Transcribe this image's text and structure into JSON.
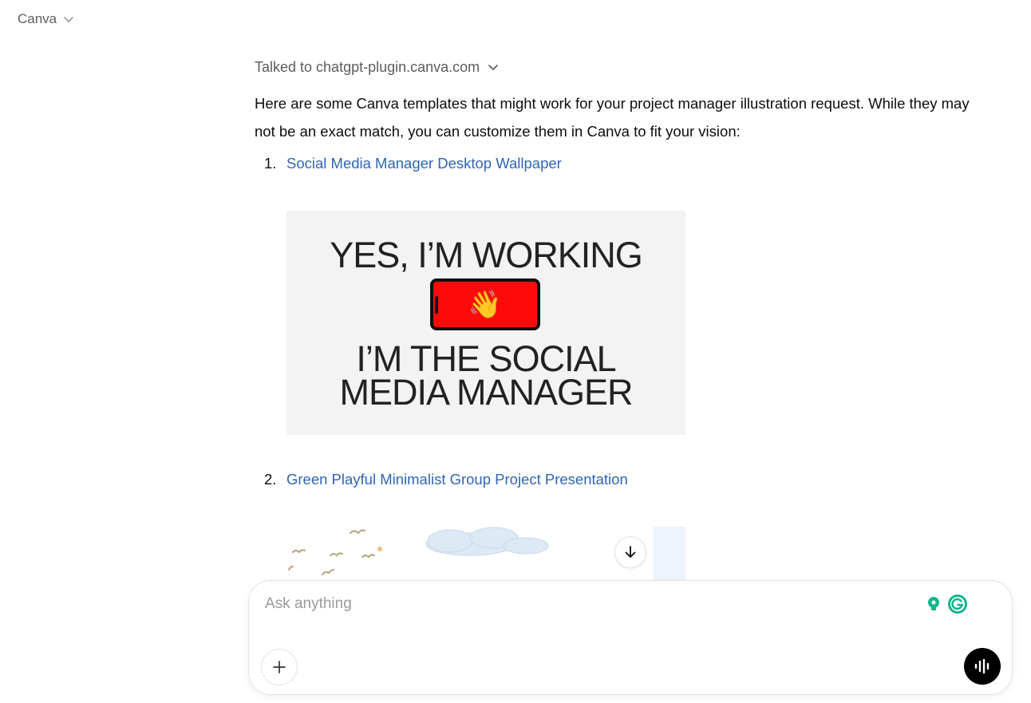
{
  "header": {
    "model_label": "Canva"
  },
  "message": {
    "tool_status": "Talked to chatgpt-plugin.canva.com",
    "intro": "Here are some Canva templates that might work for your project manager illustration request. While they may not be an exact match, you can customize them in Canva to fit your vision:",
    "items": [
      {
        "number": "1.",
        "title": "Social Media Manager Desktop Wallpaper",
        "thumbnail": {
          "line1": "YES, I’M WORKING",
          "line2": "I’M THE SOCIAL",
          "line3": "MEDIA MANAGER",
          "emoji": "👋",
          "phone_color": "#ff0a0a",
          "background": "#f3f3f3"
        }
      },
      {
        "number": "2.",
        "title": "Green Playful Minimalist Group Project Presentation"
      }
    ]
  },
  "composer": {
    "placeholder": "Ask anything",
    "value": ""
  },
  "icons": {
    "model_chevron": "chevron-down-icon",
    "tool_chevron": "chevron-down-icon",
    "scroll_down": "arrow-down-icon",
    "attach": "plus-icon",
    "voice": "voice-mode-icon",
    "extension_1": "lightbulb-icon",
    "extension_2": "grammarly-icon"
  },
  "colors": {
    "link": "#2f65b6",
    "muted_text": "#5d5d5d",
    "voice_button": "#000000",
    "extension_teal": "#15b58e"
  }
}
